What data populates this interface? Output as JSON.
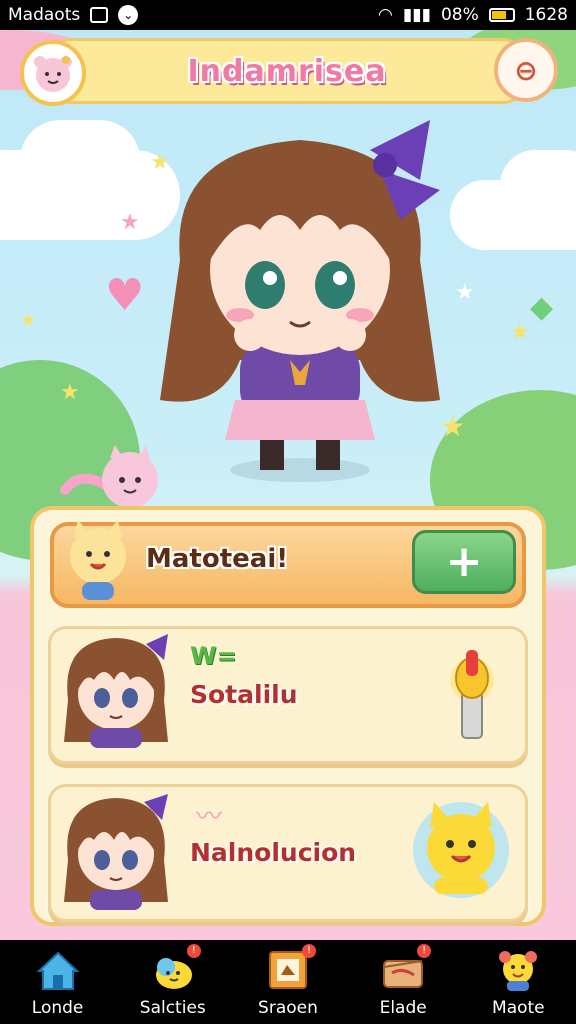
{
  "status_bar": {
    "app_name": "Madaots",
    "time_text": "1628",
    "battery_text": "08%"
  },
  "header": {
    "title": "Indamrisea"
  },
  "banner": {
    "label": "Matoteai!",
    "add_symbol": "+"
  },
  "cards": [
    {
      "name": "Sotalilu",
      "badge": "W=",
      "item_icon": "magic-wand-icon"
    },
    {
      "name": "Nalnolucion",
      "badge": "",
      "item_icon": "yellow-cat-icon"
    }
  ],
  "nav": {
    "items": [
      {
        "label": "Londe",
        "icon": "home-icon",
        "badge": false
      },
      {
        "label": "Salcties",
        "icon": "chick-icon",
        "badge": true
      },
      {
        "label": "Sraoen",
        "icon": "frame-icon",
        "badge": true
      },
      {
        "label": "Elade",
        "icon": "chest-icon",
        "badge": true
      },
      {
        "label": "Maote",
        "icon": "mascot-icon",
        "badge": false
      }
    ]
  },
  "colors": {
    "sky": "#bfe9f6",
    "panel": "#fdf5d9",
    "accent_orange": "#f5b763",
    "accent_green": "#4fae5d",
    "title_pink": "#f07aa4"
  }
}
